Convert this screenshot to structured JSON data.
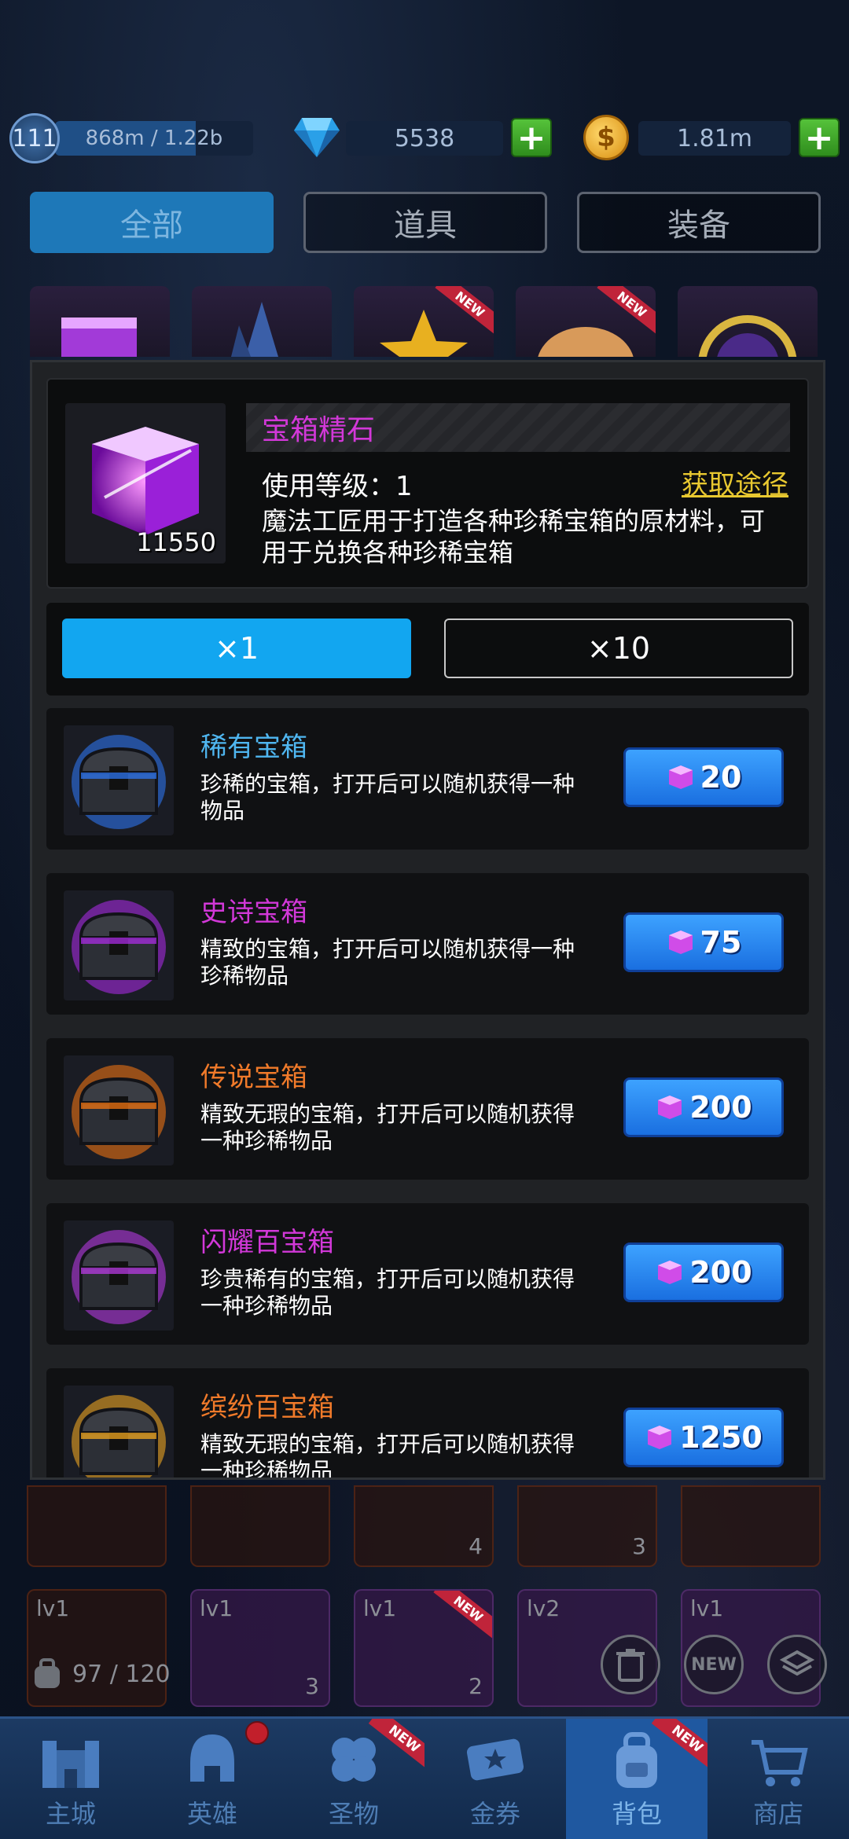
{
  "header": {
    "player_level": "111",
    "xp_text": "868m / 1.22b",
    "xp_progress": 0.71,
    "gems": "5538",
    "coins": "1.81m",
    "icons": [
      "gem-icon",
      "coin-icon",
      "plus-icon"
    ]
  },
  "filter_tabs": [
    {
      "label": "全部",
      "active": true
    },
    {
      "label": "道具",
      "active": false
    },
    {
      "label": "装备",
      "active": false
    }
  ],
  "strip_badges": [
    "NEW",
    "NEW"
  ],
  "item": {
    "name": "宝箱精石",
    "count": "11550",
    "use_level": "使用等级：1",
    "obtain_link": "获取途径",
    "description": "魔法工匠用于打造各种珍稀宝箱的原材料，可用于兑换各种珍稀宝箱",
    "name_color": "#d238d8"
  },
  "quantity": [
    {
      "label": "×1",
      "active": true
    },
    {
      "label": "×10",
      "active": false
    }
  ],
  "chests": [
    {
      "name": "稀有宝箱",
      "desc": "珍稀的宝箱，打开后可以随机获得一种物品",
      "price": "20",
      "name_color": "#4fb6f0",
      "glow": "#2f7cff"
    },
    {
      "name": "史诗宝箱",
      "desc": "精致的宝箱，打开后可以随机获得一种珍稀物品",
      "price": "75",
      "name_color": "#d238d8",
      "glow": "#b22cf0"
    },
    {
      "name": "传说宝箱",
      "desc": "精致无瑕的宝箱，打开后可以随机获得一种珍稀物品",
      "price": "200",
      "name_color": "#f07a2a",
      "glow": "#ff7a10"
    },
    {
      "name": "闪耀百宝箱",
      "desc": "珍贵稀有的宝箱，打开后可以随机获得一种珍稀物品",
      "price": "200",
      "name_color": "#d238d8",
      "glow": "#c23cf0"
    },
    {
      "name": "缤纷百宝箱",
      "desc": "精致无瑕的宝箱，打开后可以随机获得一种珍稀物品",
      "price": "1250",
      "name_color": "#f07a2a",
      "glow": "#ffb020"
    }
  ],
  "inventory": {
    "row1_counts": [
      "",
      "",
      "4",
      "3",
      ""
    ],
    "row2_levels": [
      "lv1",
      "lv1",
      "lv1",
      "lv2",
      "lv1"
    ],
    "row2_counts": [
      "",
      "3",
      "2",
      "",
      ""
    ],
    "row2_badge": "NEW",
    "bag_count": "97 / 120",
    "tools": [
      "trash-icon",
      "new-icon",
      "layers-icon"
    ],
    "tool_new_label": "NEW"
  },
  "nav": [
    {
      "label": "主城",
      "icon": "castle-icon",
      "active": false
    },
    {
      "label": "英雄",
      "icon": "helmet-icon",
      "active": false,
      "dot": true
    },
    {
      "label": "圣物",
      "icon": "clover-icon",
      "active": false,
      "badge": "NEW"
    },
    {
      "label": "金券",
      "icon": "ticket-icon",
      "active": false
    },
    {
      "label": "背包",
      "icon": "backpack-icon",
      "active": true,
      "badge": "NEW"
    },
    {
      "label": "商店",
      "icon": "cart-icon",
      "active": false
    }
  ]
}
